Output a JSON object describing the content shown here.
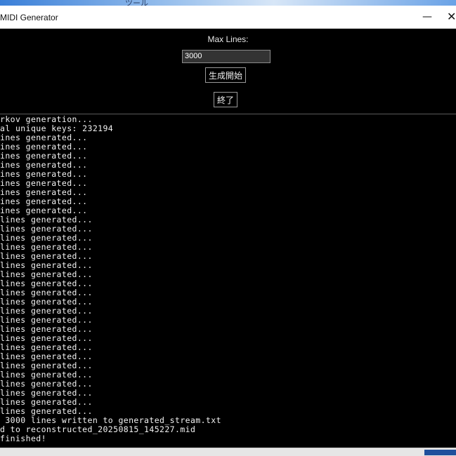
{
  "window": {
    "title": "MIDI Generator",
    "minimize_glyph": "—",
    "close_glyph": "✕",
    "background_text": "ツール"
  },
  "controls": {
    "max_lines_label": "Max Lines:",
    "max_lines_value": "3000",
    "start_button": "生成開始",
    "end_button": "終了"
  },
  "log": [
    "rkov generation...",
    "al unique keys: 232194",
    "ines generated...",
    "ines generated...",
    "ines generated...",
    "ines generated...",
    "ines generated...",
    "ines generated...",
    "ines generated...",
    "ines generated...",
    "ines generated...",
    "lines generated...",
    "lines generated...",
    "lines generated...",
    "lines generated...",
    "lines generated...",
    "lines generated...",
    "lines generated...",
    "lines generated...",
    "lines generated...",
    "lines generated...",
    "lines generated...",
    "lines generated...",
    "lines generated...",
    "lines generated...",
    "lines generated...",
    "lines generated...",
    "lines generated...",
    "lines generated...",
    "lines generated...",
    "lines generated...",
    "lines generated...",
    "lines generated...",
    " 3000 lines written to generated_stream.txt",
    "d to reconstructed_20250815_145227.mid",
    "finished!"
  ],
  "colors": {
    "background": "#000000",
    "text": "#f2f2f2",
    "input_bg": "#333333"
  }
}
